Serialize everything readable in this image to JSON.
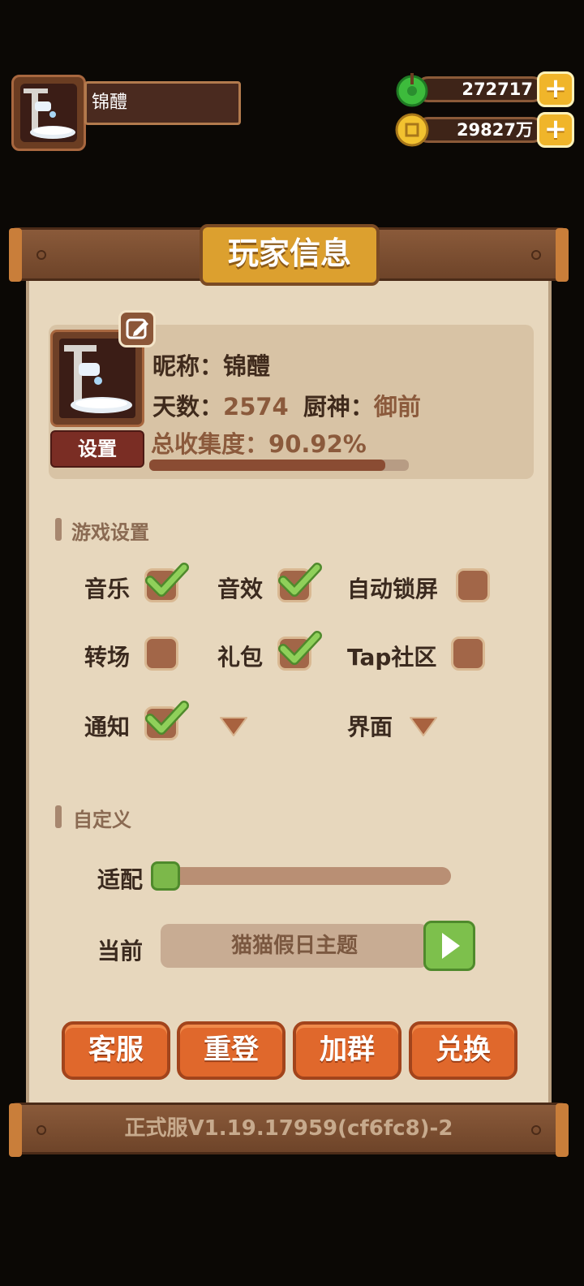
{
  "player": {
    "name": "锦醴"
  },
  "currency": {
    "jade": {
      "amount": "272717",
      "icon": "jade-icon"
    },
    "coin": {
      "amount": "29827万",
      "icon": "coin-icon"
    }
  },
  "panel": {
    "title": "玩家信息"
  },
  "profile": {
    "nickname_label": "昵称：",
    "nickname": "锦醴",
    "days_label": "天数：",
    "days": "2574",
    "chef_label": "厨神：",
    "chef": "御前",
    "collection_label": "总收集度：",
    "collection": "90.92%",
    "collection_fraction": 0.9092,
    "settings_button": "设置"
  },
  "game_settings": {
    "title": "游戏设置",
    "options": [
      {
        "label": "音乐",
        "checked": true
      },
      {
        "label": "音效",
        "checked": true
      },
      {
        "label": "自动锁屏",
        "checked": false
      },
      {
        "label": "转场",
        "checked": false
      },
      {
        "label": "礼包",
        "checked": true
      },
      {
        "label": "Tap社区",
        "checked": false
      },
      {
        "label": "通知",
        "checked": true
      },
      {
        "label": "界面",
        "checked": null
      }
    ]
  },
  "custom": {
    "title": "自定义",
    "adapt_label": "适配",
    "adapt_level": 0,
    "current_label": "当前",
    "theme": "猫猫假日主题"
  },
  "actions": [
    "客服",
    "重登",
    "加群",
    "兑换"
  ],
  "version": "正式服V1.19.17959(cf6fc8)-2",
  "colors": {
    "accent_orange": "#e0682c",
    "check_green": "#7cb84a",
    "panel_bg": "#e7d7bd",
    "title_gold": "#dca02f"
  }
}
